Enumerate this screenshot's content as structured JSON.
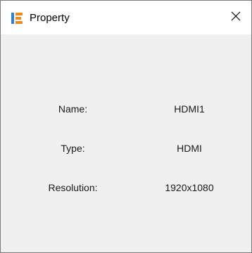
{
  "window": {
    "title": "Property",
    "app_icon": "ie-logo-icon",
    "close_icon": "close-icon",
    "close_glyph": "✕"
  },
  "properties": [
    {
      "label": "Name:",
      "value": "HDMI1"
    },
    {
      "label": "Type:",
      "value": "HDMI"
    },
    {
      "label": "Resolution:",
      "value": "1920x1080"
    }
  ],
  "colors": {
    "icon_blue": "#2f7fd6",
    "icon_orange": "#f08a1c",
    "content_bg": "#f0f0f0",
    "titlebar_bg": "#ffffff"
  }
}
